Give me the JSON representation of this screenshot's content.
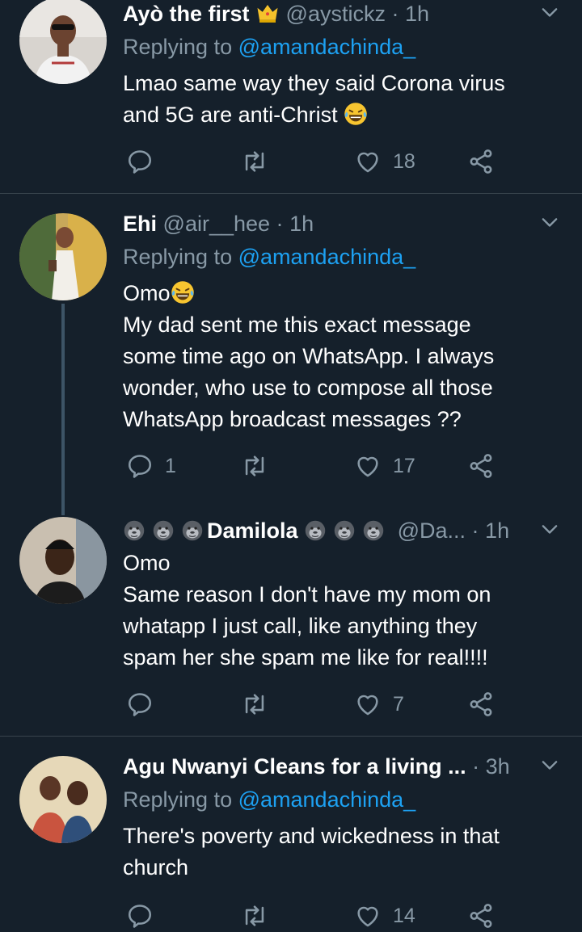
{
  "tweets": [
    {
      "name": "Ayò the first",
      "badge_icon": "crown-emoji",
      "handle": "@aystickz",
      "time": "1h",
      "reply_prefix": "Replying to",
      "reply_to": "@amandachinda_",
      "lines": [
        "Lmao same way they said Corona virus",
        "and 5G are anti-Christ"
      ],
      "emoji": "laughing-tears-emoji",
      "replies": "",
      "likes": "18"
    },
    {
      "name": "Ehi",
      "handle": "@air__hee",
      "time": "1h",
      "reply_prefix": "Replying to",
      "reply_to": "@amandachinda_",
      "lines": [
        "Omo",
        "My dad sent me this exact message",
        "some time ago on WhatsApp. I always",
        "wonder, who use to compose all those",
        "WhatsApp broadcast messages ??"
      ],
      "replies": "1",
      "likes": "17"
    },
    {
      "name": "Damilola",
      "name_icon": "gorilla-emoji",
      "handle": "@Da...",
      "time": "1h",
      "lines": [
        "Omo",
        "Same reason I don't have my mom on",
        "whatapp I just call, like anything they",
        "spam her she spam me like for real!!!!"
      ],
      "replies": "",
      "likes": "7"
    },
    {
      "name": "Agu Nwanyi Cleans for a living ...",
      "handle": "",
      "time": "3h",
      "reply_prefix": "Replying to",
      "reply_to": "@amandachinda_",
      "lines": [
        "There's poverty and wickedness in that",
        "church"
      ],
      "replies": "",
      "likes": "14"
    }
  ],
  "colors": {
    "background": "#15202b",
    "secondary_text": "#8899a6",
    "accent": "#1da1f2",
    "divider": "#38444d"
  }
}
